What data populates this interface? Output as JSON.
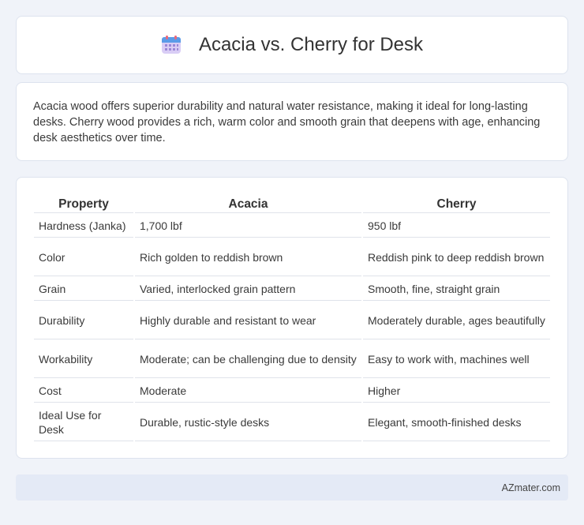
{
  "header": {
    "title": "Acacia vs. Cherry for Desk"
  },
  "summary": {
    "text": "Acacia wood offers superior durability and natural water resistance, making it ideal for long-lasting desks. Cherry wood provides a rich, warm color and smooth grain that deepens with age, enhancing desk aesthetics over time."
  },
  "table": {
    "headers": [
      "Property",
      "Acacia",
      "Cherry"
    ],
    "rows": [
      {
        "property": "Hardness (Janka)",
        "acacia": "1,700 lbf",
        "cherry": "950 lbf"
      },
      {
        "property": "Color",
        "acacia": "Rich golden to reddish brown",
        "cherry": "Reddish pink to deep reddish brown"
      },
      {
        "property": "Grain",
        "acacia": "Varied, interlocked grain pattern",
        "cherry": "Smooth, fine, straight grain"
      },
      {
        "property": "Durability",
        "acacia": "Highly durable and resistant to wear",
        "cherry": "Moderately durable, ages beautifully"
      },
      {
        "property": "Workability",
        "acacia": "Moderate; can be challenging due to density",
        "cherry": "Easy to work with, machines well"
      },
      {
        "property": "Cost",
        "acacia": "Moderate",
        "cherry": "Higher"
      },
      {
        "property": "Ideal Use for Desk",
        "acacia": "Durable, rustic-style desks",
        "cherry": "Elegant, smooth-finished desks"
      }
    ]
  },
  "footer": {
    "brand": "AZmater.com"
  },
  "colors": {
    "background": "#f0f3f9",
    "card": "#ffffff",
    "footer": "#e4eaf6",
    "icon_header": "#4a90e2",
    "icon_body": "#c9b6f0"
  },
  "icons": {
    "title_icon": "calendar-icon"
  }
}
